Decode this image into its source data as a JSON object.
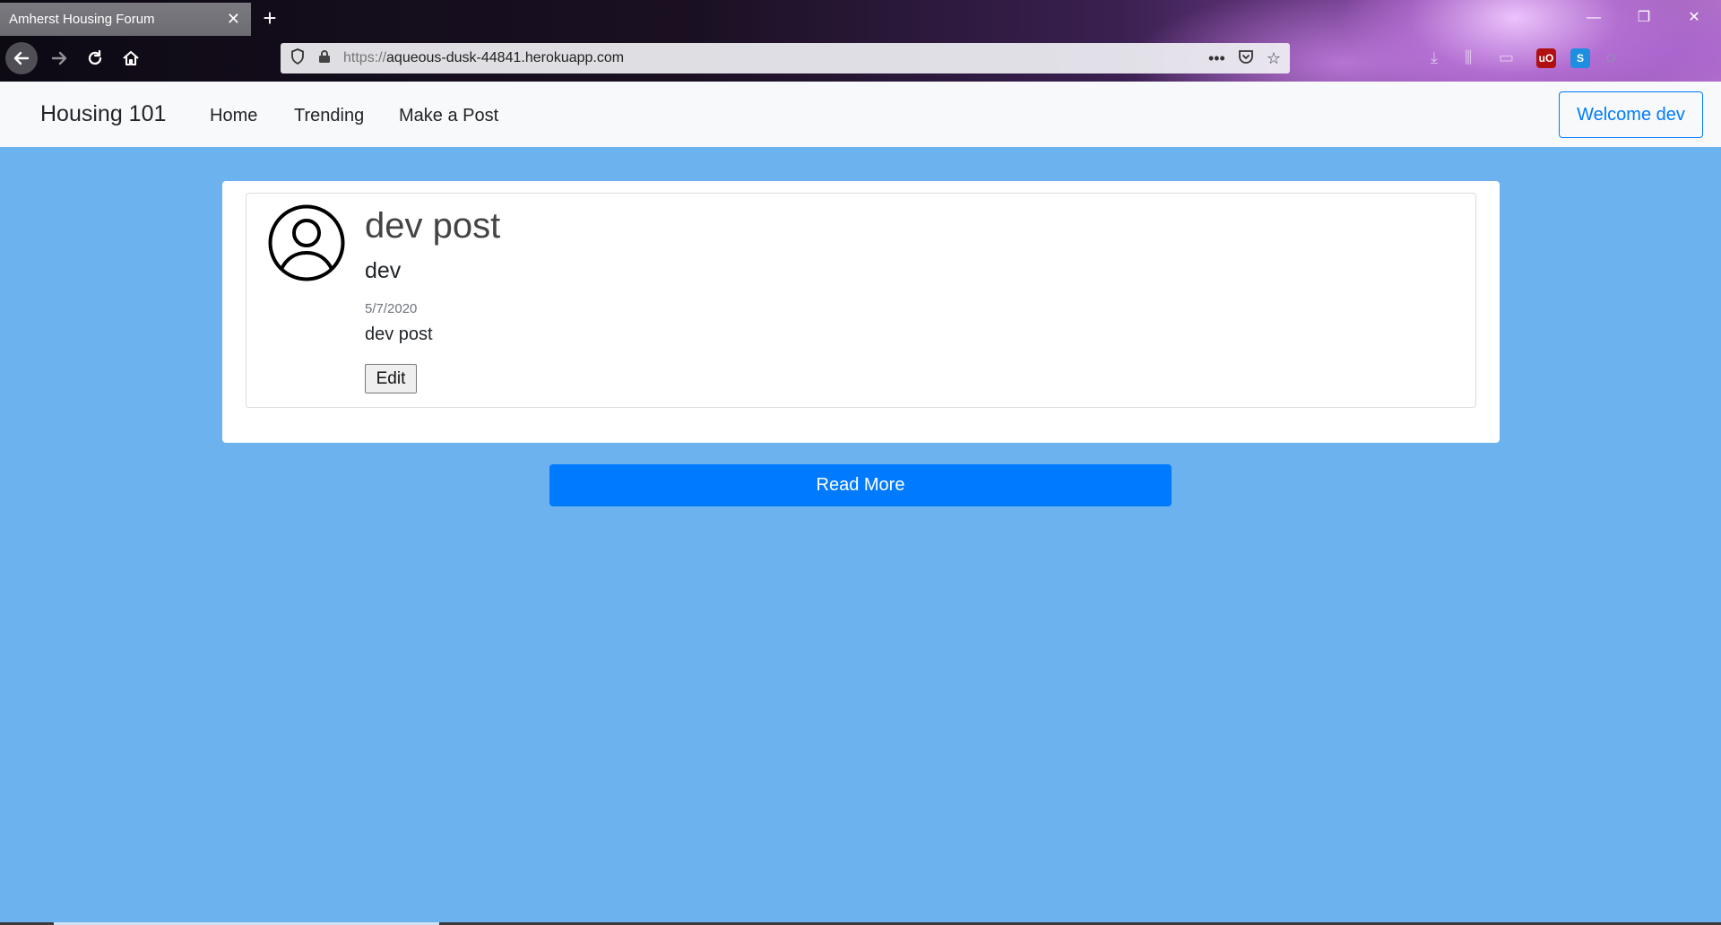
{
  "browser": {
    "tab_title": "Amherst Housing Forum",
    "tab_close": "✕",
    "new_tab": "+",
    "window_controls": {
      "minimize": "—",
      "restore": "❐",
      "close": "✕"
    },
    "url_protocol": "https://",
    "url_host": "aqueous-dusk-44841.herokuapp.com",
    "icons": [
      "back-icon",
      "forward-icon",
      "reload-icon",
      "home-icon",
      "shield-icon",
      "lock-icon",
      "more-icon",
      "pocket-icon",
      "star-icon"
    ],
    "extensions": {
      "ublock_label": "uO",
      "ublock_color": "#b01010",
      "skype_label": "S",
      "skype_color": "#1e8ee0"
    }
  },
  "site_nav": {
    "brand": "Housing 101",
    "links": [
      "Home",
      "Trending",
      "Make a Post"
    ],
    "welcome": "Welcome dev"
  },
  "post": {
    "title": "dev post",
    "author": "dev",
    "date": "5/7/2020",
    "body": "dev post",
    "edit_label": "Edit"
  },
  "read_more": "Read More",
  "colors": {
    "page_bg": "#6cb2ee",
    "primary": "#007bff",
    "navbar_bg": "#f8f9fa"
  }
}
